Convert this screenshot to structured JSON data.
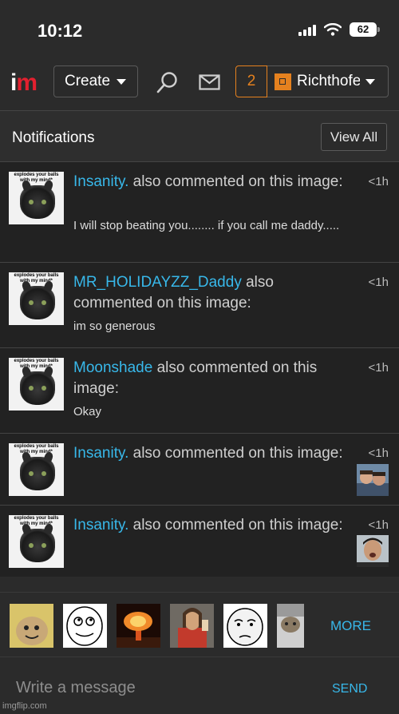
{
  "status_bar": {
    "time": "10:12",
    "battery": "62"
  },
  "nav": {
    "logo_i": "i",
    "logo_m": "m",
    "create_label": "Create",
    "notification_count": "2",
    "username": "Richthofe"
  },
  "notifications_panel": {
    "title": "Notifications",
    "view_all_label": "View All",
    "thumb_caption": "explodes your balls with my mind*",
    "items": [
      {
        "user": "Insanity.",
        "action": " also commented on this image:",
        "comment": "I will stop beating you........ if you call me daddy.....",
        "time": "<1h"
      },
      {
        "user": "MR_HOLIDAYZZ_Daddy",
        "action": " also commented on this image:",
        "comment": "im so generous",
        "time": "<1h"
      },
      {
        "user": "Moonshade",
        "action": " also commented on this image:",
        "comment": "Okay",
        "time": "<1h"
      },
      {
        "user": "Insanity.",
        "action": " also commented on this image:",
        "comment": "",
        "time": "<1h"
      },
      {
        "user": "Insanity.",
        "action": " also commented on this image:",
        "comment": "",
        "time": "<1h"
      }
    ]
  },
  "meme_bar": {
    "more_label": "MORE"
  },
  "compose": {
    "placeholder": "Write a message",
    "send_label": "SEND"
  },
  "watermark": "imgflip.com",
  "colors": {
    "link": "#38b8ea",
    "accent": "#e5811f",
    "brand_red": "#e3202f",
    "background": "#222222"
  }
}
